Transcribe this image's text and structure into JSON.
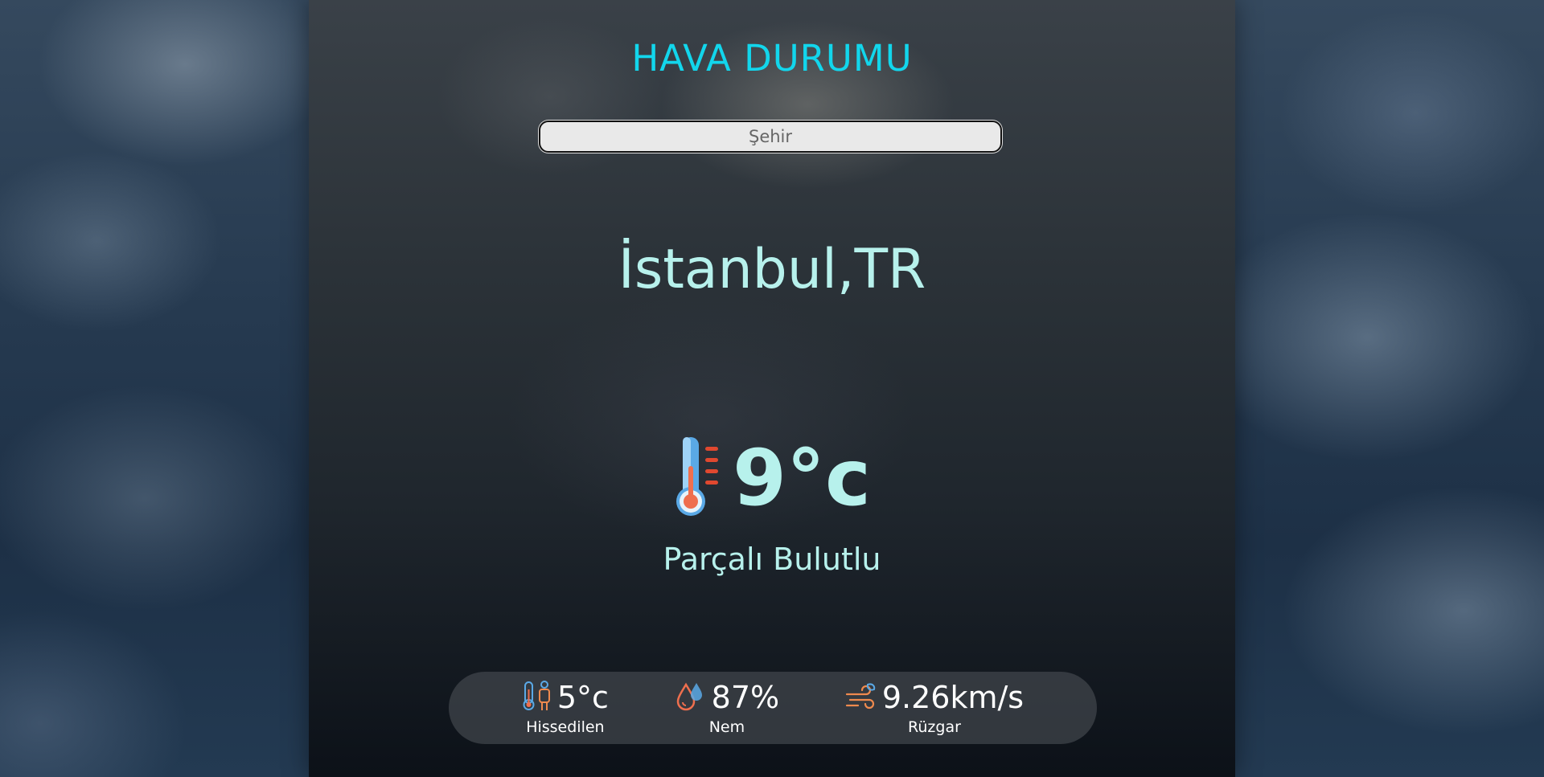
{
  "app": {
    "title": "HAVA DURUMU"
  },
  "search": {
    "placeholder": "Şehir",
    "value": ""
  },
  "location": {
    "city": "İstanbul,TR"
  },
  "current": {
    "temperature": "9°c",
    "description": "Parçalı Bulutlu"
  },
  "details": {
    "feels_like": {
      "value": "5°c",
      "label": "Hissedilen",
      "icon": "feels-like-icon"
    },
    "humidity": {
      "value": "87%",
      "label": "Nem",
      "icon": "humidity-icon"
    },
    "wind": {
      "value": "9.26km/s",
      "label": "Rüzgar",
      "icon": "wind-icon"
    }
  },
  "colors": {
    "title": "#12d6ec",
    "accent_text": "#b7f1ec",
    "detail_text": "#ffffff"
  }
}
